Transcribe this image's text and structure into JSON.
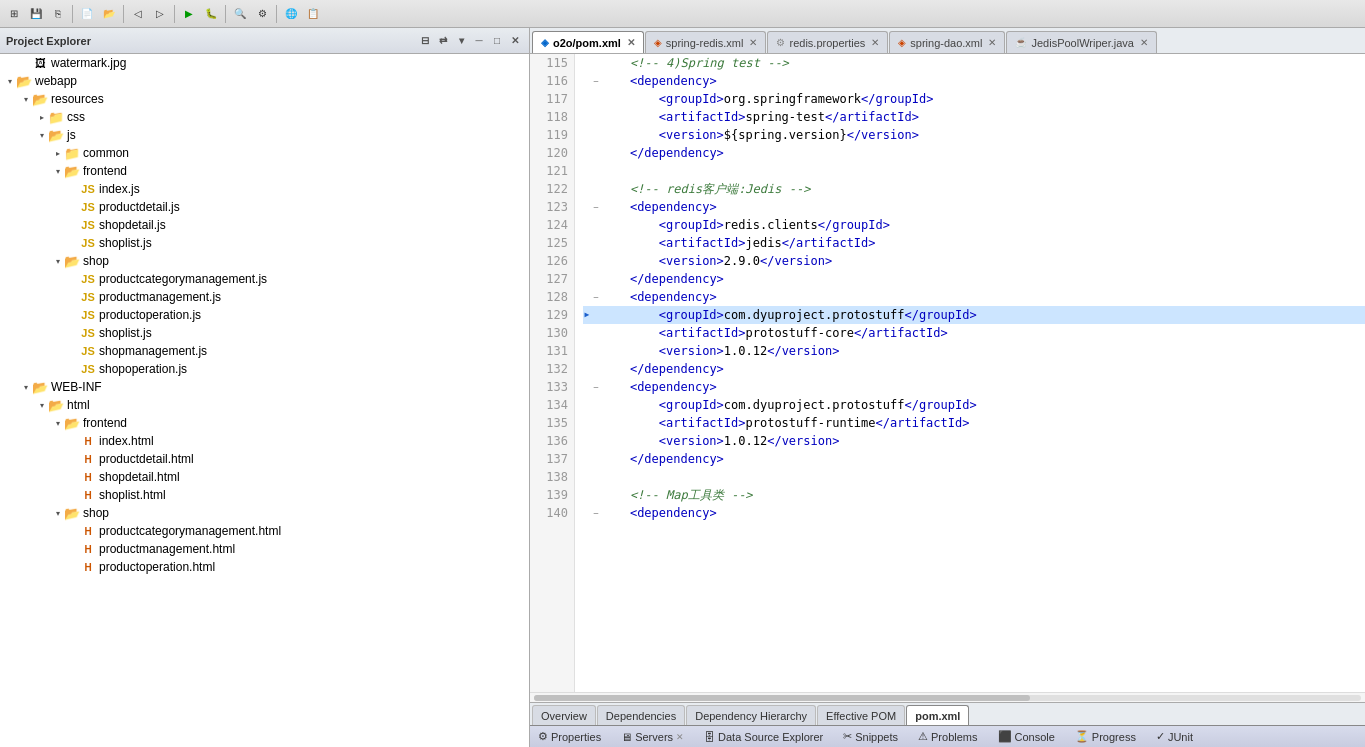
{
  "toolbar": {
    "buttons": [
      "⊞",
      "💾",
      "⎘",
      "✂",
      "⊟",
      "⟲",
      "⟳",
      "◼",
      "▶",
      "⏸",
      "⏹",
      "⚙",
      "🔍",
      "🔧"
    ]
  },
  "left_panel": {
    "title": "Project Explorer",
    "close_icon": "✕",
    "tree": [
      {
        "id": "watermark",
        "label": "watermark.jpg",
        "type": "file-img",
        "indent": 1
      },
      {
        "id": "webapp",
        "label": "webapp",
        "type": "folder-open",
        "indent": 0,
        "expanded": true
      },
      {
        "id": "resources",
        "label": "resources",
        "type": "folder-open",
        "indent": 1,
        "expanded": true
      },
      {
        "id": "css",
        "label": "css",
        "type": "folder",
        "indent": 2,
        "expanded": false
      },
      {
        "id": "js",
        "label": "js",
        "type": "folder-open",
        "indent": 2,
        "expanded": true
      },
      {
        "id": "common",
        "label": "common",
        "type": "folder",
        "indent": 3,
        "expanded": false
      },
      {
        "id": "frontend",
        "label": "frontend",
        "type": "folder-open",
        "indent": 3,
        "expanded": true
      },
      {
        "id": "index-js",
        "label": "index.js",
        "type": "file-js",
        "indent": 4
      },
      {
        "id": "productdetail-js",
        "label": "productdetail.js",
        "type": "file-js",
        "indent": 4
      },
      {
        "id": "shopdetail-js",
        "label": "shopdetail.js",
        "type": "file-js",
        "indent": 4
      },
      {
        "id": "shoplist-js",
        "label": "shoplist.js",
        "type": "file-js",
        "indent": 4
      },
      {
        "id": "shop",
        "label": "shop",
        "type": "folder-open",
        "indent": 3,
        "expanded": true
      },
      {
        "id": "productcategorymanagement-js",
        "label": "productcategorymanagement.js",
        "type": "file-js",
        "indent": 4
      },
      {
        "id": "productmanagement-js",
        "label": "productmanagement.js",
        "type": "file-js",
        "indent": 4
      },
      {
        "id": "productoperation-js",
        "label": "productoperation.js",
        "type": "file-js",
        "indent": 4
      },
      {
        "id": "shoplist2-js",
        "label": "shoplist.js",
        "type": "file-js",
        "indent": 4
      },
      {
        "id": "shopmanagement-js",
        "label": "shopmanagement.js",
        "type": "file-js",
        "indent": 4
      },
      {
        "id": "shopoperation-js",
        "label": "shopoperation.js",
        "type": "file-js",
        "indent": 4
      },
      {
        "id": "web-inf",
        "label": "WEB-INF",
        "type": "folder-open",
        "indent": 1,
        "expanded": true
      },
      {
        "id": "html",
        "label": "html",
        "type": "folder-open",
        "indent": 2,
        "expanded": true
      },
      {
        "id": "frontend2",
        "label": "frontend",
        "type": "folder-open",
        "indent": 3,
        "expanded": true
      },
      {
        "id": "index-html",
        "label": "index.html",
        "type": "file-html",
        "indent": 4
      },
      {
        "id": "productdetail-html",
        "label": "productdetail.html",
        "type": "file-html",
        "indent": 4
      },
      {
        "id": "shopdetail-html",
        "label": "shopdetail.html",
        "type": "file-html",
        "indent": 4
      },
      {
        "id": "shoplist-html",
        "label": "shoplist.html",
        "type": "file-html",
        "indent": 4
      },
      {
        "id": "shop2",
        "label": "shop",
        "type": "folder-open",
        "indent": 3,
        "expanded": true
      },
      {
        "id": "productcategorymanagement-html",
        "label": "productcategorymanagement.html",
        "type": "file-html",
        "indent": 4
      },
      {
        "id": "productmanagement-html",
        "label": "productmanagement.html",
        "type": "file-html",
        "indent": 4
      },
      {
        "id": "productoperation-html",
        "label": "productoperation.html",
        "type": "file-html",
        "indent": 4
      }
    ]
  },
  "editor": {
    "tabs": [
      {
        "label": "o2o/pom.xml",
        "active": true,
        "modified": false,
        "icon": "xml"
      },
      {
        "label": "spring-redis.xml",
        "active": false,
        "modified": false,
        "icon": "xml"
      },
      {
        "label": "redis.properties",
        "active": false,
        "modified": false,
        "icon": "properties"
      },
      {
        "label": "spring-dao.xml",
        "active": false,
        "modified": false,
        "icon": "xml"
      },
      {
        "label": "JedisPoolWriper.java",
        "active": false,
        "modified": false,
        "icon": "java"
      }
    ],
    "lines": [
      {
        "num": "115",
        "content": "    <!-- 4)Spring test -->",
        "type": "comment",
        "fold": false,
        "indicator": false
      },
      {
        "num": "116",
        "content": "    <dependency>",
        "type": "tag",
        "fold": true,
        "indicator": false
      },
      {
        "num": "117",
        "content": "        <groupId>org.springframework</groupId>",
        "type": "tag",
        "fold": false,
        "indicator": false
      },
      {
        "num": "118",
        "content": "        <artifactId>spring-test</artifactId>",
        "type": "tag",
        "fold": false,
        "indicator": false
      },
      {
        "num": "119",
        "content": "        <version>${spring.version}</version>",
        "type": "tag",
        "fold": false,
        "indicator": false
      },
      {
        "num": "120",
        "content": "    </dependency>",
        "type": "tag",
        "fold": false,
        "indicator": false
      },
      {
        "num": "121",
        "content": "",
        "type": "empty",
        "fold": false,
        "indicator": false
      },
      {
        "num": "122",
        "content": "    <!-- redis客户端:Jedis -->",
        "type": "comment",
        "fold": false,
        "indicator": false
      },
      {
        "num": "123",
        "content": "    <dependency>",
        "type": "tag",
        "fold": true,
        "indicator": false
      },
      {
        "num": "124",
        "content": "        <groupId>redis.clients</groupId>",
        "type": "tag",
        "fold": false,
        "indicator": false
      },
      {
        "num": "125",
        "content": "        <artifactId>jedis</artifactId>",
        "type": "tag",
        "fold": false,
        "indicator": false
      },
      {
        "num": "126",
        "content": "        <version>2.9.0</version>",
        "type": "tag",
        "fold": false,
        "indicator": false
      },
      {
        "num": "127",
        "content": "    </dependency>",
        "type": "tag",
        "fold": false,
        "indicator": false
      },
      {
        "num": "128",
        "content": "    <dependency>",
        "type": "tag",
        "fold": true,
        "indicator": false
      },
      {
        "num": "129",
        "content": "        <groupId>com.dyuproject.protostuff</groupId>",
        "type": "tag",
        "fold": false,
        "indicator": true,
        "highlighted": true
      },
      {
        "num": "130",
        "content": "        <artifactId>protostuff-core</artifactId>",
        "type": "tag",
        "fold": false,
        "indicator": false
      },
      {
        "num": "131",
        "content": "        <version>1.0.12</version>",
        "type": "tag",
        "fold": false,
        "indicator": false
      },
      {
        "num": "132",
        "content": "    </dependency>",
        "type": "tag",
        "fold": false,
        "indicator": false
      },
      {
        "num": "133",
        "content": "    <dependency>",
        "type": "tag",
        "fold": true,
        "indicator": false
      },
      {
        "num": "134",
        "content": "        <groupId>com.dyuproject.protostuff</groupId>",
        "type": "tag",
        "fold": false,
        "indicator": false
      },
      {
        "num": "135",
        "content": "        <artifactId>protostuff-runtime</artifactId>",
        "type": "tag",
        "fold": false,
        "indicator": false
      },
      {
        "num": "136",
        "content": "        <version>1.0.12</version>",
        "type": "tag",
        "fold": false,
        "indicator": false
      },
      {
        "num": "137",
        "content": "    </dependency>",
        "type": "tag",
        "fold": false,
        "indicator": false
      },
      {
        "num": "138",
        "content": "",
        "type": "empty",
        "fold": false,
        "indicator": false
      },
      {
        "num": "139",
        "content": "    <!-- Map工具类 -->",
        "type": "comment",
        "fold": false,
        "indicator": false
      },
      {
        "num": "140",
        "content": "    <dependency>",
        "type": "tag",
        "fold": true,
        "indicator": false
      }
    ]
  },
  "bottom_tabs": [
    {
      "label": "Overview",
      "active": false
    },
    {
      "label": "Dependencies",
      "active": false
    },
    {
      "label": "Dependency Hierarchy",
      "active": false
    },
    {
      "label": "Effective POM",
      "active": false
    },
    {
      "label": "pom.xml",
      "active": true
    }
  ],
  "status_bar": {
    "items": [
      {
        "icon": "⚙",
        "label": "Properties"
      },
      {
        "icon": "🖥",
        "label": "Servers",
        "closeable": true
      },
      {
        "icon": "🗄",
        "label": "Data Source Explorer"
      },
      {
        "icon": "✂",
        "label": "Snippets"
      },
      {
        "icon": "⚠",
        "label": "Problems"
      },
      {
        "icon": "⬛",
        "label": "Console"
      },
      {
        "icon": "⏳",
        "label": "Progress"
      },
      {
        "icon": "✓",
        "label": "JUnit"
      }
    ]
  }
}
